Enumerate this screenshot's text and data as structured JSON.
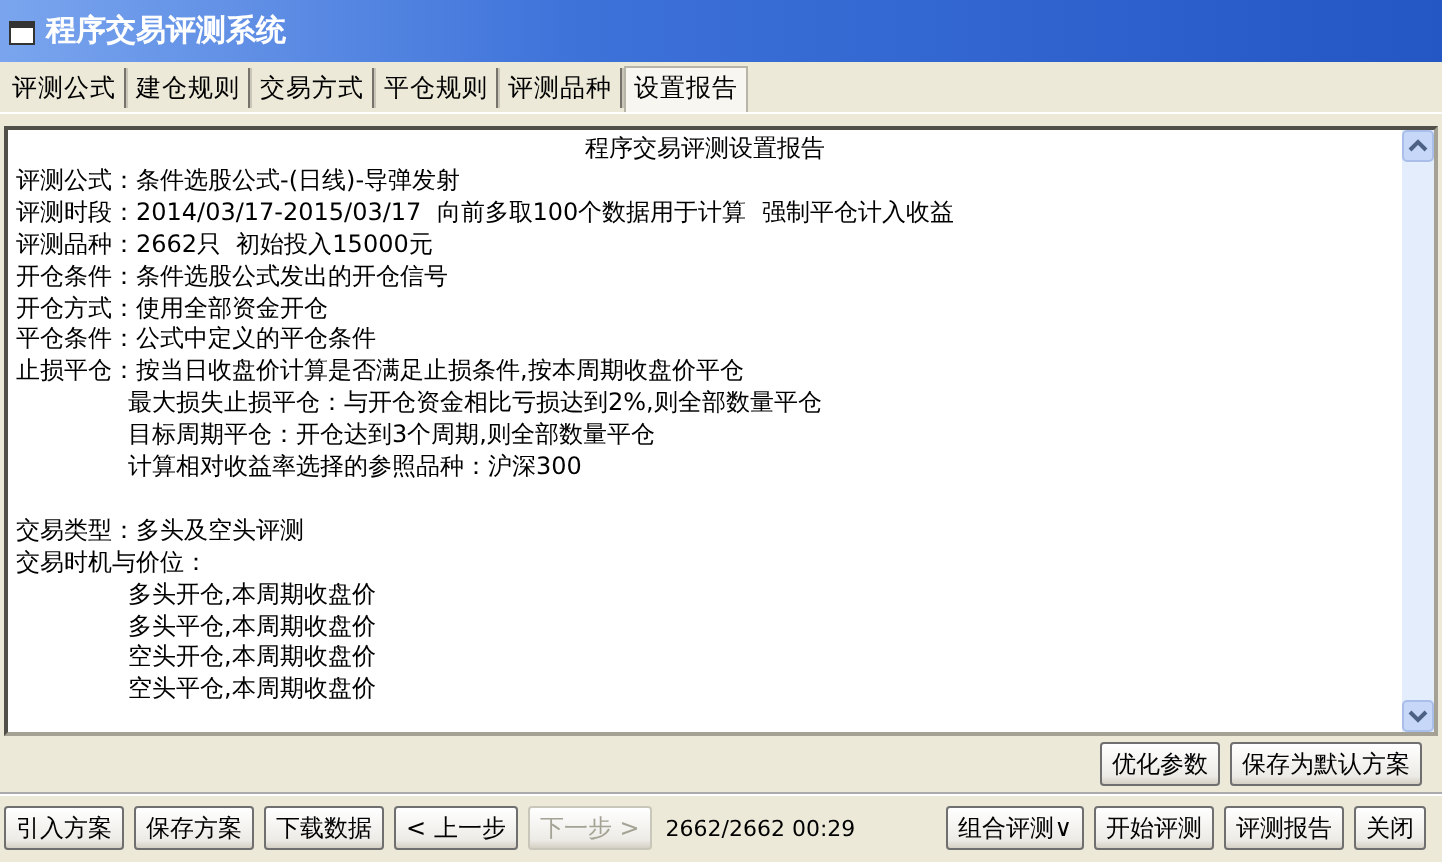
{
  "window": {
    "title": "程序交易评测系统"
  },
  "tabs": [
    {
      "label": "评测公式",
      "selected": false
    },
    {
      "label": "建仓规则",
      "selected": false
    },
    {
      "label": "交易方式",
      "selected": false
    },
    {
      "label": "平仓规则",
      "selected": false
    },
    {
      "label": "评测品种",
      "selected": false
    },
    {
      "label": "设置报告",
      "selected": true
    }
  ],
  "report": {
    "title": "程序交易评测设置报告",
    "lines": [
      {
        "kind": "line",
        "text": "评测公式：条件选股公式-(日线)-导弹发射"
      },
      {
        "kind": "line",
        "text": "评测时段：2014/03/17-2015/03/17  向前多取100个数据用于计算  强制平仓计入收益"
      },
      {
        "kind": "line",
        "text": "评测品种：2662只  初始投入15000元"
      },
      {
        "kind": "line",
        "text": "开仓条件：条件选股公式发出的开仓信号"
      },
      {
        "kind": "line",
        "text": "开仓方式：使用全部资金开仓"
      },
      {
        "kind": "line",
        "text": "平仓条件：公式中定义的平仓条件"
      },
      {
        "kind": "line",
        "text": "止损平仓：按当日收盘价计算是否满足止损条件,按本周期收盘价平仓"
      },
      {
        "kind": "sub",
        "text": "最大损失止损平仓：与开仓资金相比亏损达到2%,则全部数量平仓"
      },
      {
        "kind": "sub",
        "text": "目标周期平仓：开仓达到3个周期,则全部数量平仓"
      },
      {
        "kind": "sub",
        "text": "计算相对收益率选择的参照品种：沪深300"
      },
      {
        "kind": "gap"
      },
      {
        "kind": "line",
        "text": "交易类型：多头及空头评测"
      },
      {
        "kind": "line",
        "text": "交易时机与价位："
      },
      {
        "kind": "sub",
        "text": "多头开仓,本周期收盘价"
      },
      {
        "kind": "sub",
        "text": "多头平仓,本周期收盘价"
      },
      {
        "kind": "sub",
        "text": "空头开仓,本周期收盘价"
      },
      {
        "kind": "sub",
        "text": "空头平仓,本周期收盘价"
      }
    ]
  },
  "report_buttons": [
    "优化参数",
    "保存为默认方案"
  ],
  "toolbar": {
    "left_buttons": [
      {
        "label": "引入方案",
        "disabled": false
      },
      {
        "label": "保存方案",
        "disabled": false
      },
      {
        "label": "下载数据",
        "disabled": false
      },
      {
        "label": "< 上一步",
        "disabled": false
      },
      {
        "label": "下一步 >",
        "disabled": true
      }
    ],
    "status": "2662/2662 00:29",
    "right_buttons": [
      {
        "label": "组合评测∨",
        "disabled": false
      },
      {
        "label": "开始评测",
        "disabled": false
      },
      {
        "label": "评测报告",
        "disabled": false
      },
      {
        "label": "关闭",
        "disabled": false
      }
    ]
  }
}
